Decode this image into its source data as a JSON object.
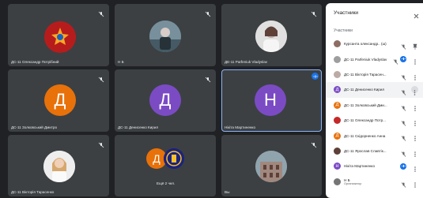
{
  "tiles": [
    {
      "name": "ДС-11 Олександр Потрібний",
      "avatar": "army-emblem",
      "menu": true
    },
    {
      "name": "Н Б",
      "avatar": "photo",
      "menu": true
    },
    {
      "name": "ДЕ-11 Parfeniuk Vladyslav",
      "avatar": "photo",
      "menu": true
    },
    {
      "name": "ДС-11 Золковський Дмитро",
      "avatar_letter": "Д",
      "color": "#e8710a"
    },
    {
      "name": "ДС-11 Денисенко Кирил",
      "avatar_letter": "Д",
      "color": "#7b4bc4"
    },
    {
      "name": "Нікіта Мартиненко",
      "avatar_letter": "Н",
      "color": "#7b4bc4"
    },
    {
      "name": "ДС-11 Вікторія Тарасенко",
      "avatar": "photo"
    },
    {
      "name": "Ещё 2 чел.",
      "avatar_letter": "Д",
      "color": "#e8710a"
    },
    {
      "name": "Вы",
      "avatar": "photo"
    }
  ],
  "panel": {
    "title": "Участники",
    "section_label": "Участники",
    "participants": [
      {
        "name": "Курсанта олександр.. (ш)",
        "color": "#8d6e63",
        "letter": ""
      },
      {
        "name": "ДС-11 Parfeniuk Vladyslav",
        "color": "#9e9e9e",
        "letter": ""
      },
      {
        "name": "ДС-11 Вікторія Тарасен...",
        "color": "#bcaaa4",
        "letter": ""
      },
      {
        "name": "ДС-11 Денисенко Кирил",
        "color": "#7b4bc4",
        "letter": "Д"
      },
      {
        "name": "ДС-11 Золковський Дми...",
        "color": "#e8710a",
        "letter": "Д"
      },
      {
        "name": "ДС-11 Олександр Потр...",
        "color": "#c62828",
        "letter": ""
      },
      {
        "name": "ДС-11 Скідорненко Анна",
        "color": "#e8710a",
        "letter": "Д"
      },
      {
        "name": "ДС-11 Ярослав Славтік...",
        "color": "#5d4037",
        "letter": ""
      },
      {
        "name": "Нікіта Мартиненко",
        "color": "#7b4bc4",
        "letter": "Н"
      },
      {
        "name": "Н Б",
        "sub": "Организатор",
        "color": "#757575",
        "letter": ""
      }
    ]
  },
  "colors": {
    "accent": "#1a73e8",
    "tile_bg": "#3c4043",
    "page_bg": "#202124"
  }
}
